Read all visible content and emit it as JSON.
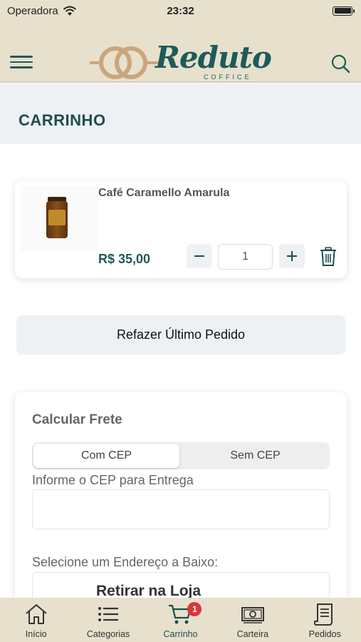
{
  "status_bar": {
    "carrier": "Operadora",
    "time": "23:32"
  },
  "header": {
    "logo_text": "Reduto",
    "logo_subtext": "COFFICE"
  },
  "page": {
    "title": "CARRINHO"
  },
  "cart": {
    "items": [
      {
        "name": "Café Caramello Amarula",
        "price": "R$ 35,00",
        "quantity": "1"
      }
    ]
  },
  "actions": {
    "redo_last_order": "Refazer Último Pedido"
  },
  "shipping": {
    "title": "Calcular Frete",
    "tabs": [
      "Com CEP",
      "Sem CEP"
    ],
    "selected_tab": "Com CEP",
    "cep_label": "Informe o CEP para Entrega",
    "cep_value": "",
    "address_label": "Selecione um Endereço a Baixo:",
    "address_selected": "Retirar na Loja"
  },
  "tabbar": {
    "items": [
      {
        "label": "Início",
        "icon": "home-icon"
      },
      {
        "label": "Categorias",
        "icon": "list-icon"
      },
      {
        "label": "Carrinho",
        "icon": "cart-icon"
      },
      {
        "label": "Carteira",
        "icon": "wallet-icon"
      },
      {
        "label": "Pedidos",
        "icon": "orders-icon"
      }
    ],
    "active": "Carrinho",
    "cart_badge": "1"
  },
  "colors": {
    "brand": "#1e4d4d",
    "header_bg": "#e7e0cd",
    "badge": "#d9363e",
    "accent_ring": "#c9a77c"
  }
}
